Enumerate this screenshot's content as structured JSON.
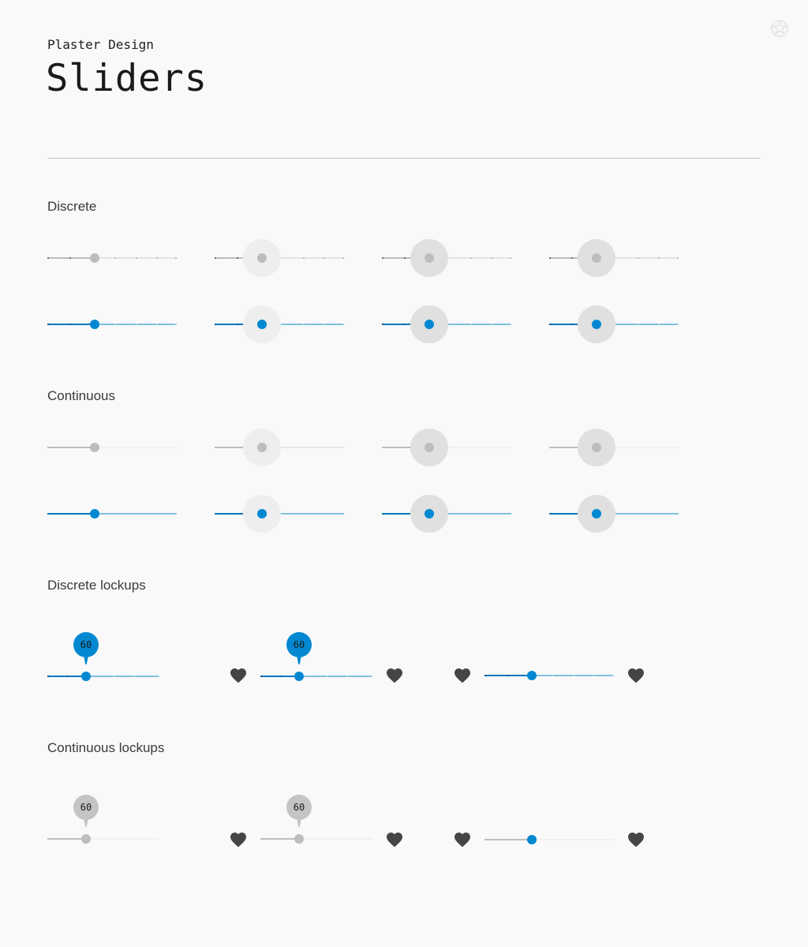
{
  "header": {
    "brand": "Plaster Design",
    "title": "Sliders"
  },
  "sections": {
    "discrete": "Discrete",
    "continuous": "Continuous",
    "discrete_lockups": "Discrete lockups",
    "continuous_lockups": "Continuous lockups"
  },
  "lockups": {
    "discrete_value": "60",
    "discrete_value_2": "60",
    "continuous_value": "60",
    "continuous_value_2": "60"
  },
  "icons": {
    "logo": "plaster-logo-icon",
    "favorite": "heart-icon"
  },
  "colors": {
    "accent": "#0288d1",
    "accent_dark": "#0277bd",
    "accent_light": "#7fc0e3",
    "inactive": "#bdbdbd",
    "background": "#f9f9f9"
  },
  "slider_values": {
    "rows": 0.37,
    "lockups": 0.34
  }
}
